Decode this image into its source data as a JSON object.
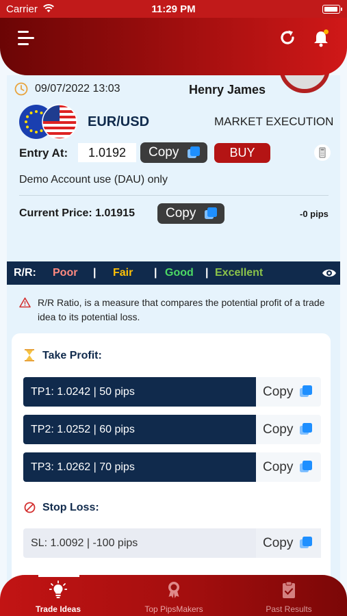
{
  "status_bar": {
    "carrier": "Carrier",
    "time": "11:29 PM"
  },
  "trade": {
    "datetime": "09/07/2022 13:03",
    "user_name": "Henry James",
    "pair": "EUR/USD",
    "execution": "MARKET EXECUTION",
    "entry_label": "Entry At:",
    "entry_value": "1.0192",
    "copy_label": "Copy",
    "buy_label": "BUY",
    "demo_note": "Demo Account use (DAU) only",
    "current_price_label": "Current Price: 1.01915",
    "pips": "-0 pips"
  },
  "rr": {
    "label": "R/R:",
    "levels": [
      {
        "label": "Poor",
        "color": "#ff8a80"
      },
      {
        "label": "Fair",
        "color": "#ffc107"
      },
      {
        "label": "Good",
        "color": "#4cd964"
      },
      {
        "label": "Excellent",
        "color": "#8bc34a"
      }
    ],
    "separator": "|",
    "note": "R/R Ratio, is a measure that compares the potential profit of a trade idea to its potential loss."
  },
  "take_profit": {
    "title": "Take Profit:",
    "items": [
      {
        "text": "TP1: 1.0242 | 50 pips"
      },
      {
        "text": "TP2: 1.0252 | 60 pips"
      },
      {
        "text": "TP3: 1.0262 | 70 pips"
      }
    ]
  },
  "stop_loss": {
    "title": "Stop Loss:",
    "text": "SL: 1.0092 | -100 pips"
  },
  "nav": {
    "items": [
      {
        "label": "Trade Ideas",
        "active": true
      },
      {
        "label": "Top PipsMakers",
        "active": false
      },
      {
        "label": "Past Results",
        "active": false
      }
    ]
  },
  "colors": {
    "brand_red": "#b41414",
    "navy": "#102a4c",
    "copy_blue": "#1e8fff"
  }
}
